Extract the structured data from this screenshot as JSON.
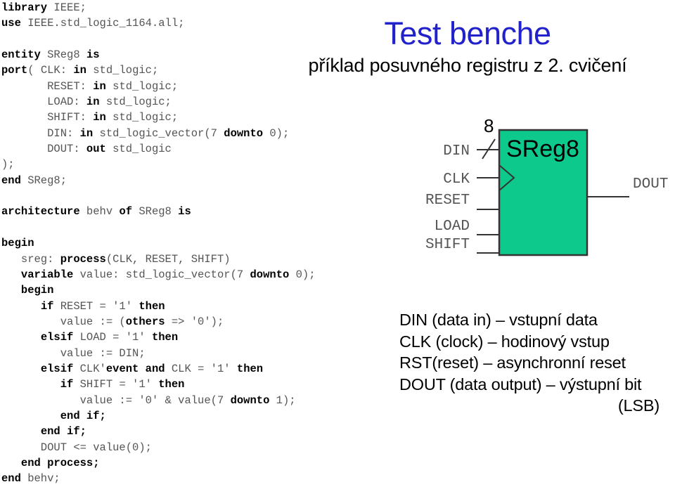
{
  "title": {
    "main": "Test benche",
    "subtitle": "příklad posuvného registru z 2. cvičení",
    "main_color": "#2222CC",
    "subtitle_color": "#000000"
  },
  "code": {
    "language": "VHDL",
    "lines": [
      [
        {
          "t": "library",
          "b": true
        },
        {
          "t": " IEEE;",
          "b": false
        }
      ],
      [
        {
          "t": "use",
          "b": true
        },
        {
          "t": " IEEE.std_logic_1164.all;",
          "b": false
        }
      ],
      [],
      [
        {
          "t": "entity",
          "b": true
        },
        {
          "t": " SReg8 ",
          "b": false
        },
        {
          "t": "is",
          "b": true
        }
      ],
      [
        {
          "t": "port",
          "b": true
        },
        {
          "t": "( CLK: ",
          "b": false
        },
        {
          "t": "in",
          "b": true
        },
        {
          "t": " std_logic;",
          "b": false
        }
      ],
      [
        {
          "t": "       RESET: ",
          "b": false
        },
        {
          "t": "in",
          "b": true
        },
        {
          "t": " std_logic;",
          "b": false
        }
      ],
      [
        {
          "t": "       LOAD: ",
          "b": false
        },
        {
          "t": "in",
          "b": true
        },
        {
          "t": " std_logic;",
          "b": false
        }
      ],
      [
        {
          "t": "       SHIFT: ",
          "b": false
        },
        {
          "t": "in",
          "b": true
        },
        {
          "t": " std_logic;",
          "b": false
        }
      ],
      [
        {
          "t": "       DIN: ",
          "b": false
        },
        {
          "t": "in",
          "b": true
        },
        {
          "t": " std_logic_vector(7 ",
          "b": false
        },
        {
          "t": "downto",
          "b": true
        },
        {
          "t": " 0);",
          "b": false
        }
      ],
      [
        {
          "t": "       DOUT: ",
          "b": false
        },
        {
          "t": "out",
          "b": true
        },
        {
          "t": " std_logic",
          "b": false
        }
      ],
      [
        {
          "t": ");",
          "b": false
        }
      ],
      [
        {
          "t": "end",
          "b": true
        },
        {
          "t": " SReg8;",
          "b": false
        }
      ],
      [],
      [
        {
          "t": "architecture",
          "b": true
        },
        {
          "t": " behv ",
          "b": false
        },
        {
          "t": "of",
          "b": true
        },
        {
          "t": " SReg8 ",
          "b": false
        },
        {
          "t": "is",
          "b": true
        }
      ],
      [],
      [
        {
          "t": "begin",
          "b": true
        }
      ],
      [
        {
          "t": "   sreg: ",
          "b": false
        },
        {
          "t": "process",
          "b": true
        },
        {
          "t": "(CLK, RESET, SHIFT)",
          "b": false
        }
      ],
      [
        {
          "t": "   ",
          "b": false
        },
        {
          "t": "variable",
          "b": true
        },
        {
          "t": " value: std_logic_vector(7 ",
          "b": false
        },
        {
          "t": "downto",
          "b": true
        },
        {
          "t": " 0);",
          "b": false
        }
      ],
      [
        {
          "t": "   ",
          "b": false
        },
        {
          "t": "begin",
          "b": true
        }
      ],
      [
        {
          "t": "      ",
          "b": false
        },
        {
          "t": "if",
          "b": true
        },
        {
          "t": " RESET = '1' ",
          "b": false
        },
        {
          "t": "then",
          "b": true
        }
      ],
      [
        {
          "t": "         value := (",
          "b": false
        },
        {
          "t": "others",
          "b": true
        },
        {
          "t": " => '0');",
          "b": false
        }
      ],
      [
        {
          "t": "      ",
          "b": false
        },
        {
          "t": "elsif",
          "b": true
        },
        {
          "t": " LOAD = '1' ",
          "b": false
        },
        {
          "t": "then",
          "b": true
        }
      ],
      [
        {
          "t": "         value := DIN;",
          "b": false
        }
      ],
      [
        {
          "t": "      ",
          "b": false
        },
        {
          "t": "elsif",
          "b": true
        },
        {
          "t": " CLK'",
          "b": false
        },
        {
          "t": "event and",
          "b": true
        },
        {
          "t": " CLK = '1' ",
          "b": false
        },
        {
          "t": "then",
          "b": true
        }
      ],
      [
        {
          "t": "         ",
          "b": false
        },
        {
          "t": "if",
          "b": true
        },
        {
          "t": " SHIFT = '1' ",
          "b": false
        },
        {
          "t": "then",
          "b": true
        }
      ],
      [
        {
          "t": "            value := '0' & value(7 ",
          "b": false
        },
        {
          "t": "downto",
          "b": true
        },
        {
          "t": " 1);",
          "b": false
        }
      ],
      [
        {
          "t": "         ",
          "b": false
        },
        {
          "t": "end if;",
          "b": true
        }
      ],
      [
        {
          "t": "      ",
          "b": false
        },
        {
          "t": "end if;",
          "b": true
        }
      ],
      [
        {
          "t": "      DOUT <= value(0);",
          "b": false
        }
      ],
      [
        {
          "t": "   ",
          "b": false
        },
        {
          "t": "end process;",
          "b": true
        }
      ],
      [
        {
          "t": "end",
          "b": true
        },
        {
          "t": " behv;",
          "b": false
        }
      ]
    ]
  },
  "diagram": {
    "block_label": "SReg8",
    "block_fill": "#0EC98C",
    "block_stroke": "#333333",
    "bus_width": "8",
    "inputs": [
      {
        "name": "DIN",
        "bus": true,
        "width": "8"
      },
      {
        "name": "CLK",
        "bus": false,
        "clock": true
      },
      {
        "name": "RESET",
        "bus": false
      },
      {
        "name": "LOAD",
        "bus": false
      },
      {
        "name": "SHIFT",
        "bus": false
      }
    ],
    "outputs": [
      {
        "name": "DOUT"
      }
    ]
  },
  "legend": {
    "lines": [
      "DIN (data in) – vstupní data",
      "CLK (clock) – hodinový vstup",
      "RST(reset) – asynchronní reset",
      "DOUT (data output) – výstupní bit",
      "(LSB)"
    ]
  }
}
